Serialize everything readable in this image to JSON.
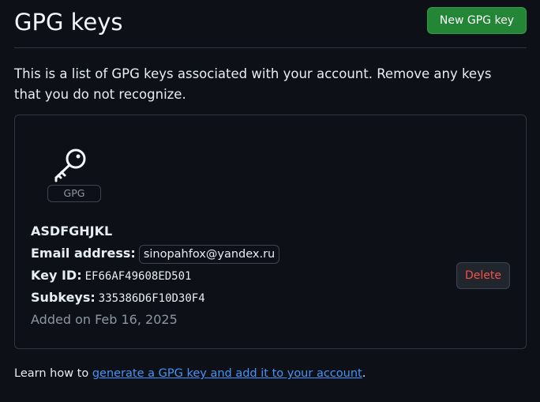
{
  "header": {
    "title": "GPG keys",
    "new_key_button": "New GPG key"
  },
  "intro": "This is a list of GPG keys associated with your account. Remove any keys that you do not recognize.",
  "key": {
    "icon": "key-icon",
    "badge": "GPG",
    "name": "ASDFGHJKL",
    "email_label": "Email address:",
    "email": "sinopahfox@yandex.ru",
    "key_id_label": "Key ID:",
    "key_id": "EF66AF49608ED501",
    "subkeys_label": "Subkeys:",
    "subkeys": "335386D6F10D30F4",
    "added_on": "Added on Feb 16, 2025",
    "delete_button": "Delete"
  },
  "footer": {
    "prefix": "Learn how to ",
    "link": "generate a GPG key and add it to your account",
    "suffix": "."
  },
  "colors": {
    "background": "#0d1117",
    "primary_button": "#238636",
    "danger_text": "#f85149",
    "link": "#4493f8"
  }
}
